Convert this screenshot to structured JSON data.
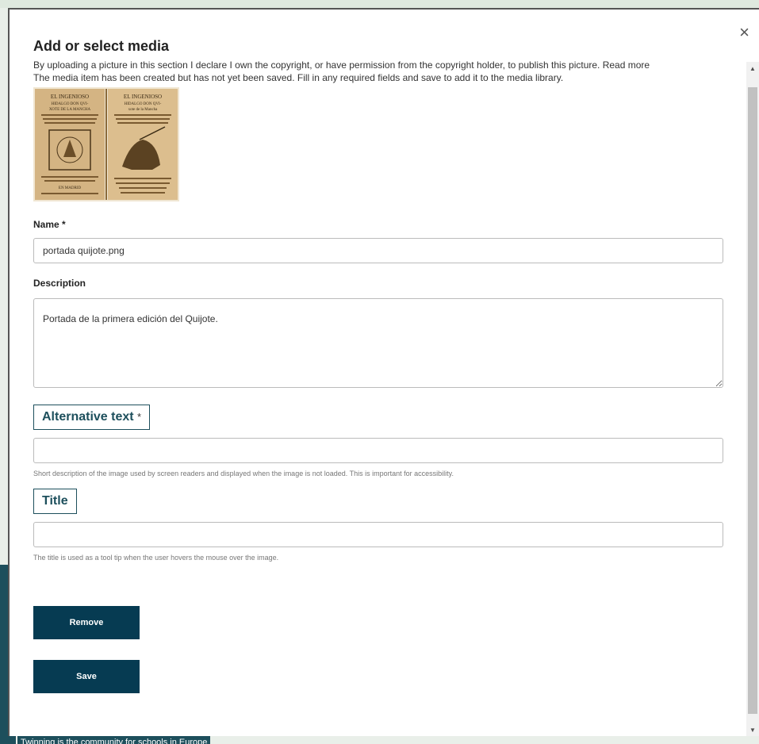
{
  "dialog": {
    "title": "Add or select media",
    "close_label": "×",
    "copyright_notice": "By uploading a picture in this section I declare I own the copyright, or have permission from the copyright holder, to publish this picture. Read more",
    "status_message": "The media item has been created but has not yet been saved. Fill in any required fields and save to add it to the media library."
  },
  "thumbnail": {
    "left_page": [
      "EL INGENIOSO",
      "HIDALGO DON QVI-",
      "XOTE DE LA MANCHA"
    ],
    "right_page": [
      "EL INGENIOSO",
      "HIDALGO DON QVI-",
      "xote de la Mancha"
    ],
    "footer": "EN MADRID"
  },
  "form": {
    "name_label": "Name *",
    "name_value": "portada quijote.png",
    "description_label": "Description",
    "description_value": "Portada de la primera edición del Quijote.",
    "alt_label": "Alternative text",
    "alt_required": "*",
    "alt_value": "",
    "alt_help": "Short description of the image used by screen readers and displayed when the image is not loaded. This is important for accessibility.",
    "title_label": "Title",
    "title_value": "",
    "title_help": "The title is used as a tool tip when the user hovers the mouse over the image."
  },
  "actions": {
    "remove_label": "Remove",
    "save_label": "Save"
  },
  "background": {
    "footer_text": "Twinning is the community for schools in Europe"
  },
  "colors": {
    "accent": "#063b52",
    "outline": "#1d4f5c"
  }
}
